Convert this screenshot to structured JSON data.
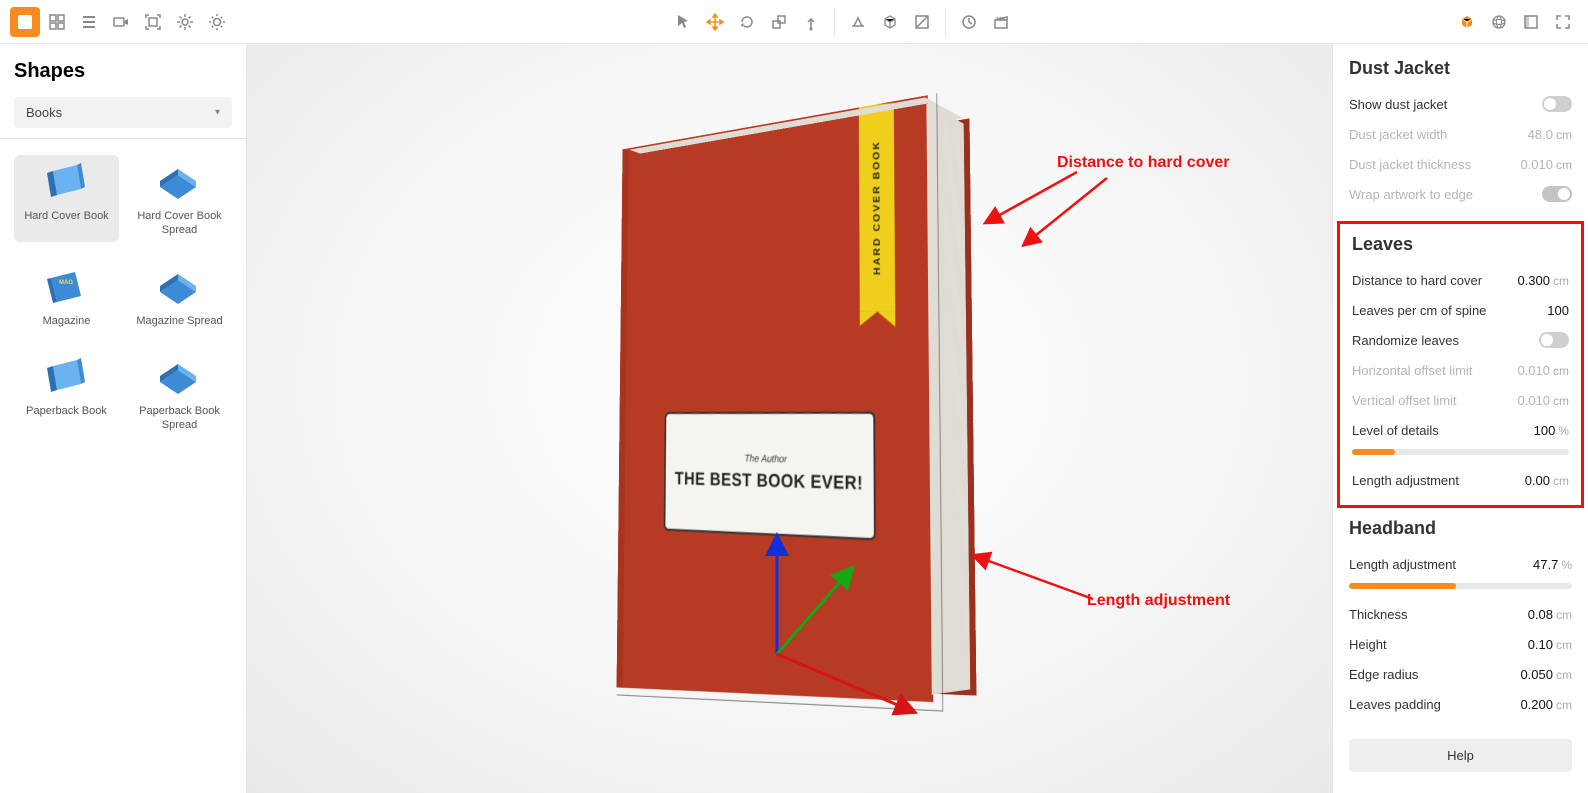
{
  "toolbar": {
    "left_group": [
      "add",
      "grid",
      "list",
      "camera",
      "focus",
      "gear",
      "sun"
    ],
    "center_group1": [
      "pointer",
      "move",
      "rotate",
      "scale",
      "pivot"
    ],
    "center_group2": [
      "ground",
      "box-wire",
      "plane"
    ],
    "center_group3": [
      "clock",
      "clapper"
    ],
    "right_group": [
      "cube-orange",
      "sphere-grid",
      "panel",
      "fullscreen"
    ]
  },
  "left": {
    "title": "Shapes",
    "dropdown_value": "Books",
    "shapes": [
      {
        "name": "Hard Cover Book",
        "selected": true
      },
      {
        "name": "Hard Cover Book Spread",
        "selected": false
      },
      {
        "name": "Magazine",
        "selected": false
      },
      {
        "name": "Magazine Spread",
        "selected": false
      },
      {
        "name": "Paperback Book",
        "selected": false
      },
      {
        "name": "Paperback Book Spread",
        "selected": false
      }
    ]
  },
  "book": {
    "author": "The Author",
    "title": "THE BEST BOOK EVER!",
    "ribbon": "HARD COVER BOOK"
  },
  "annotations": {
    "a1": "Distance to hard cover",
    "a2": "Length adjustment"
  },
  "right": {
    "dust_jacket": {
      "title": "Dust Jacket",
      "rows": [
        {
          "label": "Show dust jacket",
          "type": "toggle",
          "on": false,
          "disabled": false
        },
        {
          "label": "Dust jacket width",
          "type": "value",
          "num": "48.0",
          "unit": "cm",
          "disabled": true
        },
        {
          "label": "Dust jacket thickness",
          "type": "value",
          "num": "0.010",
          "unit": "cm",
          "disabled": true
        },
        {
          "label": "Wrap artwork to edge",
          "type": "toggle",
          "on": true,
          "disabled": true
        }
      ]
    },
    "leaves": {
      "title": "Leaves",
      "rows": [
        {
          "label": "Distance to hard cover",
          "type": "value",
          "num": "0.300",
          "unit": "cm"
        },
        {
          "label": "Leaves per cm of spine",
          "type": "value",
          "num": "100",
          "unit": ""
        },
        {
          "label": "Randomize leaves",
          "type": "toggle",
          "on": false
        },
        {
          "label": "Horizontal offset limit",
          "type": "value",
          "num": "0.010",
          "unit": "cm",
          "disabled": true
        },
        {
          "label": "Vertical offset limit",
          "type": "value",
          "num": "0.010",
          "unit": "cm",
          "disabled": true
        },
        {
          "label": "Level of details",
          "type": "value",
          "num": "100",
          "unit": "%"
        },
        {
          "label": "__slider__",
          "type": "slider",
          "percent": 20
        },
        {
          "label": "Length adjustment",
          "type": "value",
          "num": "0.00",
          "unit": "cm"
        }
      ]
    },
    "headband": {
      "title": "Headband",
      "rows": [
        {
          "label": "Length adjustment",
          "type": "value",
          "num": "47.7",
          "unit": "%"
        },
        {
          "label": "__slider__",
          "type": "slider",
          "percent": 48
        },
        {
          "label": "Thickness",
          "type": "value",
          "num": "0.08",
          "unit": "cm"
        },
        {
          "label": "Height",
          "type": "value",
          "num": "0.10",
          "unit": "cm"
        },
        {
          "label": "Edge radius",
          "type": "value",
          "num": "0.050",
          "unit": "cm"
        },
        {
          "label": "Leaves padding",
          "type": "value",
          "num": "0.200",
          "unit": "cm"
        }
      ]
    },
    "help": "Help"
  }
}
